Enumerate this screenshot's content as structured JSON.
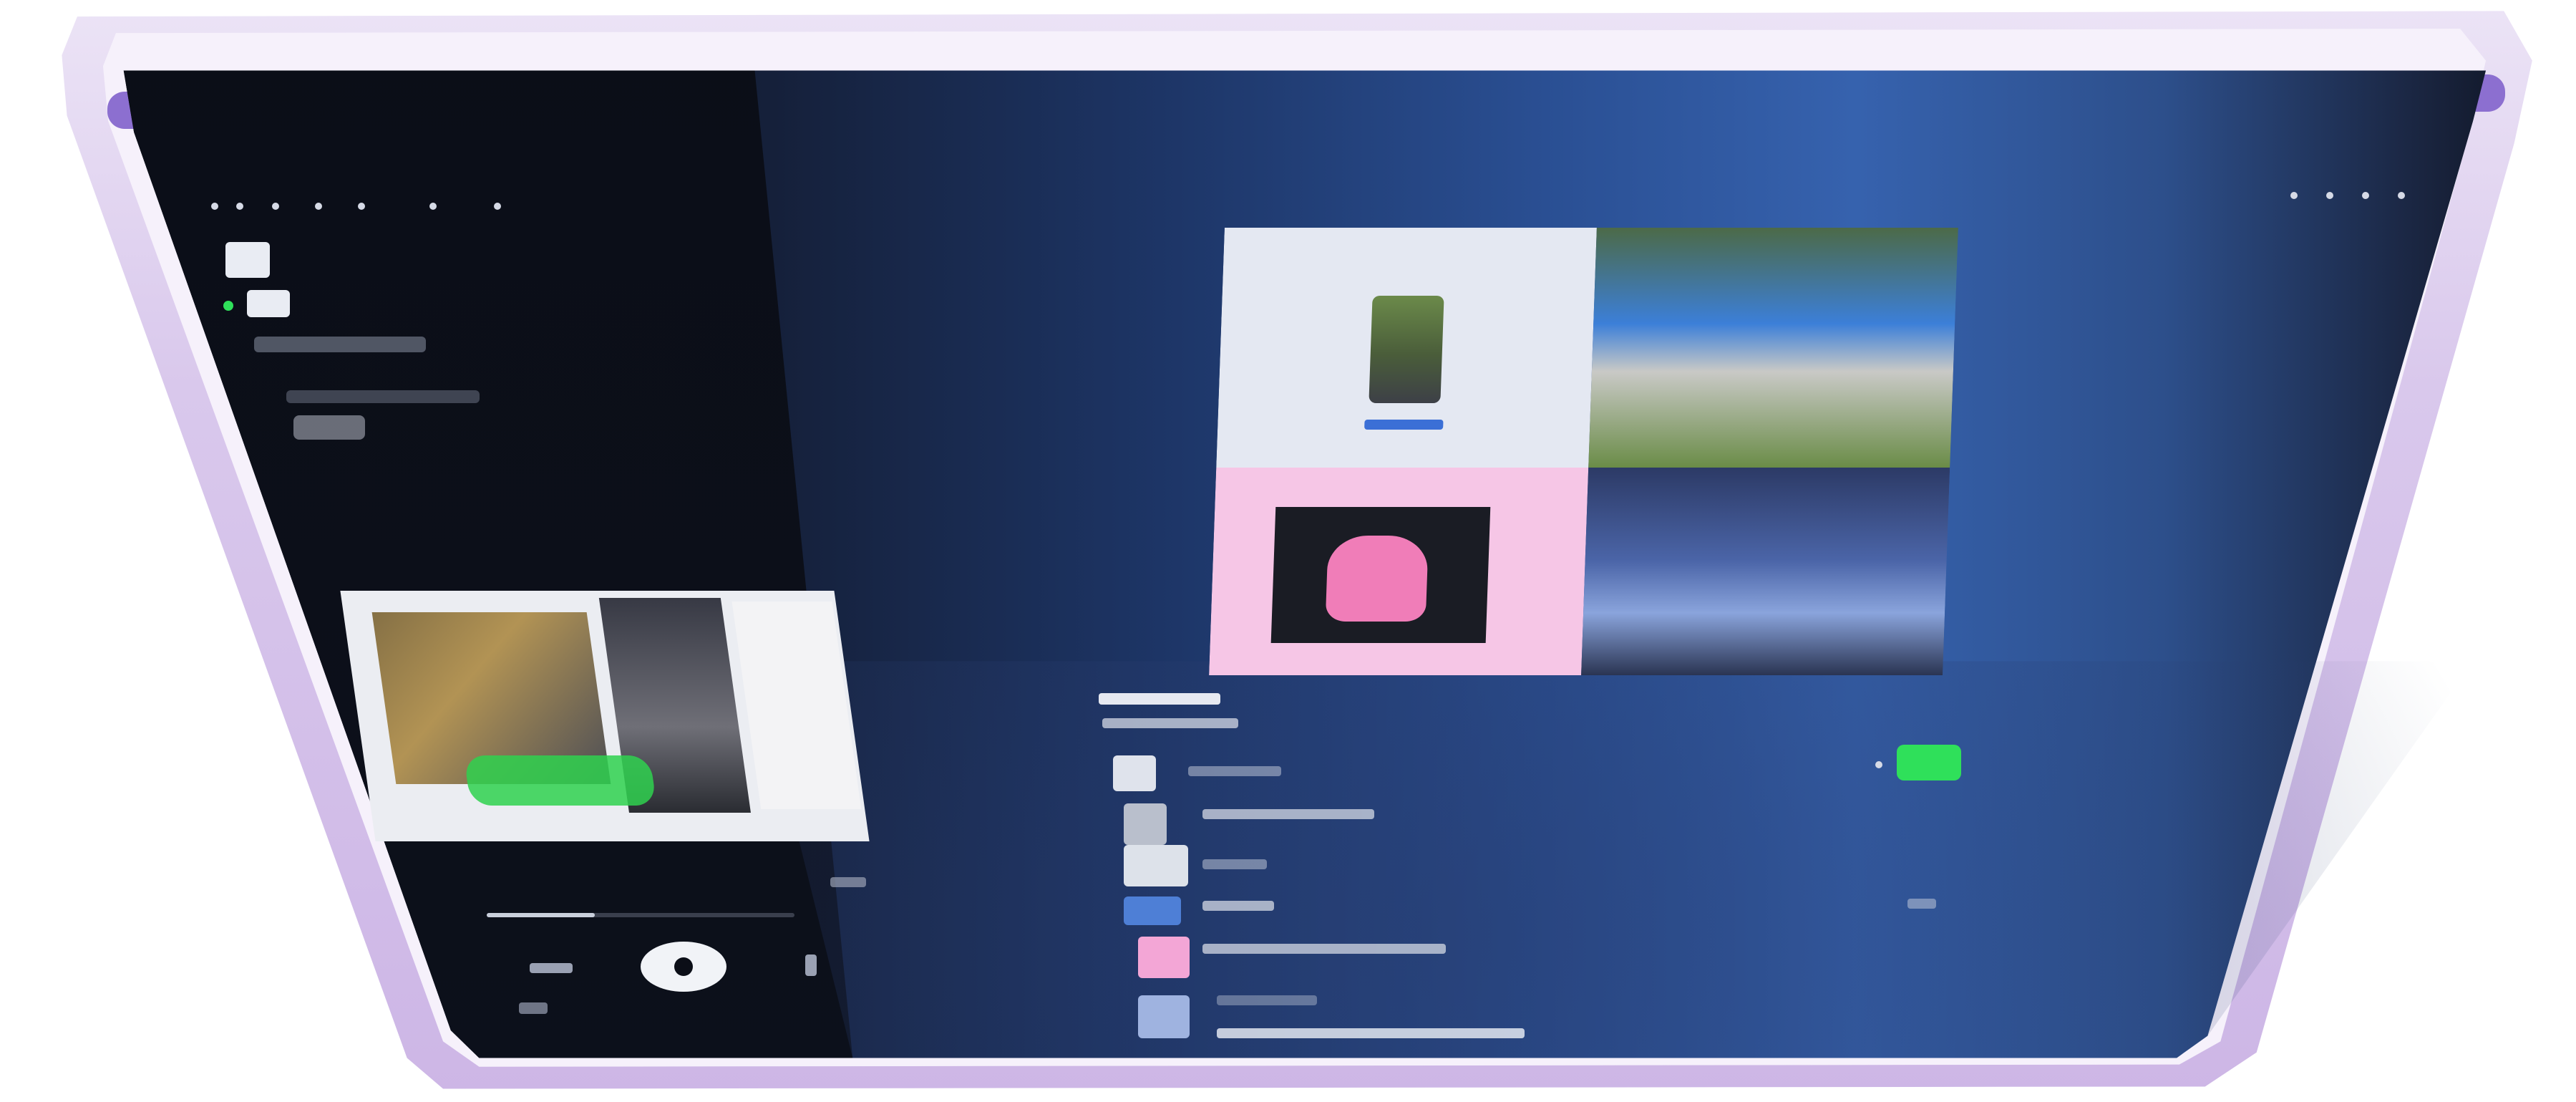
{
  "scene": {
    "colors": {
      "case": "#d9c8ec",
      "case_buttons": "#8c6fd0",
      "screen_left": "#0b0e17",
      "screen_wallpaper": "#2a4f93",
      "accent_green": "#2fe05a",
      "album_pink": "#f6c6e6"
    }
  },
  "left_panel": {
    "header_icon": "music-app-icon",
    "now_playing": {
      "has_artwork": true,
      "progress_fraction": 0.35,
      "controls": [
        "previous-icon",
        "play-pause-icon",
        "next-icon"
      ]
    }
  },
  "right_panel": {
    "album_grid_count": 4,
    "list_rows": 6,
    "indicator_icon": "green-badge-icon"
  }
}
